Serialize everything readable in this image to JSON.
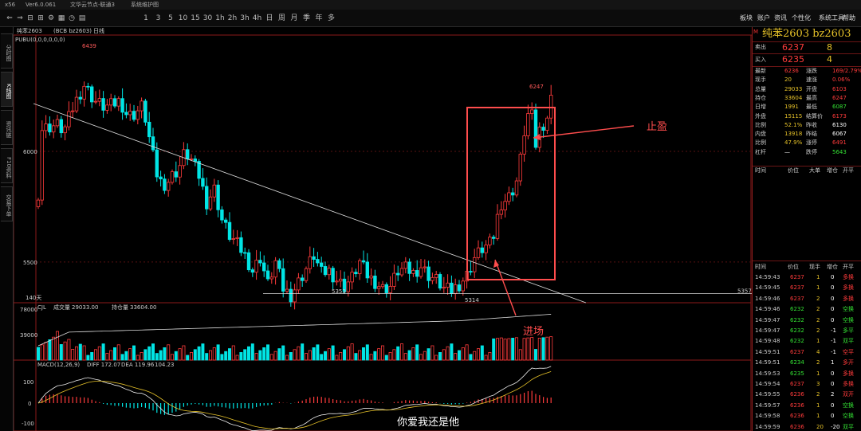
{
  "window": {
    "app_icon": "x56",
    "version": "Ver6.0.061",
    "title": "文华云节点-联通3",
    "menu": "系统维护图"
  },
  "toolbar": {
    "icons": [
      "⇐",
      "⇒",
      "⊟",
      "⊞",
      "⚙",
      "▦",
      "◷",
      "▤"
    ],
    "periods": [
      "1",
      "3",
      "5",
      "10",
      "15",
      "30",
      "1h",
      "2h",
      "3h",
      "4h",
      "日",
      "周",
      "月",
      "季",
      "年",
      "多"
    ],
    "right_menu": [
      "板块",
      "账户",
      "资讯",
      "个性化",
      "系统工具",
      "帮助"
    ]
  },
  "left_tabs": [
    "分时图",
    "K线图",
    "资讯链",
    "F10资料",
    "交易下单"
  ],
  "chart_header": {
    "symbol": "纯苯2603",
    "contract": "(BCB bz2603)",
    "period": "日线",
    "indicator": "PUBU(0,0,0,0,0,0)"
  },
  "price_axis": {
    "labels": [
      "6000",
      "5500"
    ],
    "current": "5357"
  },
  "annotations": {
    "high": "6439",
    "high2": "6247",
    "low1": "5353",
    "low2": "5314",
    "stop_label": "止盈",
    "entry_label": "进场",
    "days": "140天"
  },
  "volume": {
    "title": "CJL",
    "name_vol": "成交量",
    "vol": "29033.00",
    "name_oi": "持仓量",
    "oi": "33604.00",
    "axis": [
      "78000",
      "39000"
    ]
  },
  "macd": {
    "title": "MACD(12,26,9)",
    "diff": "DIFF 172.07",
    "dea": "DEA 119.96",
    "macd": "104.23",
    "axis": [
      "100",
      "0",
      "-100"
    ]
  },
  "subtitle": "你爱我还是他",
  "panel": {
    "m": "M",
    "title": "纯苯2603  bz2603",
    "sell_label": "卖出",
    "sell_price": "6237",
    "sell_qty": "8",
    "buy_label": "买入",
    "buy_price": "6235",
    "buy_qty": "4",
    "stats": [
      [
        "最新",
        "6236",
        "涨跌",
        "169/2.79%"
      ],
      [
        "现手",
        "20",
        "速涨",
        "0.06%"
      ],
      [
        "总量",
        "29033",
        "开盘",
        "6103"
      ],
      [
        "持仓",
        "33604",
        "最高",
        "6247"
      ],
      [
        "日增",
        "1991",
        "最低",
        "6087"
      ],
      [
        "外盘",
        "15115",
        "结算价",
        "6173"
      ],
      [
        "比例",
        "52.1%",
        "昨收",
        "6130"
      ],
      [
        "内盘",
        "13918",
        "昨结",
        "6067"
      ],
      [
        "比例",
        "47.9%",
        "涨停",
        "6491"
      ],
      [
        "杠杆",
        "—",
        "跌停",
        "5643"
      ]
    ],
    "trades_header": [
      "时间",
      "价位",
      "大单",
      "增仓",
      "开平"
    ],
    "trades2_header": [
      "时间",
      "价位",
      "现手",
      "增仓",
      "开平"
    ],
    "trades": [
      [
        "14:59:43",
        "6237",
        "1",
        "0",
        "多换"
      ],
      [
        "14:59:45",
        "6237",
        "1",
        "0",
        "多换"
      ],
      [
        "14:59:46",
        "6237",
        "2",
        "0",
        "多换"
      ],
      [
        "14:59:46",
        "6232",
        "2",
        "0",
        "空换"
      ],
      [
        "14:59:47",
        "6232",
        "2",
        "0",
        "空换"
      ],
      [
        "14:59:47",
        "6232",
        "2",
        "-1",
        "多平"
      ],
      [
        "14:59:48",
        "6232",
        "1",
        "-1",
        "双平"
      ],
      [
        "14:59:51",
        "6237",
        "4",
        "-1",
        "空平"
      ],
      [
        "14:59:51",
        "6234",
        "2",
        "1",
        "多开"
      ],
      [
        "14:59:53",
        "6235",
        "1",
        "0",
        "多换"
      ],
      [
        "14:59:54",
        "6237",
        "3",
        "0",
        "多换"
      ],
      [
        "14:59:55",
        "6236",
        "2",
        "2",
        "双开"
      ],
      [
        "14:59:57",
        "6236",
        "1",
        "0",
        "空换"
      ],
      [
        "14:59:58",
        "6236",
        "1",
        "0",
        "空换"
      ],
      [
        "14:59:59",
        "6236",
        "20",
        "-20",
        "双平"
      ]
    ]
  }
}
